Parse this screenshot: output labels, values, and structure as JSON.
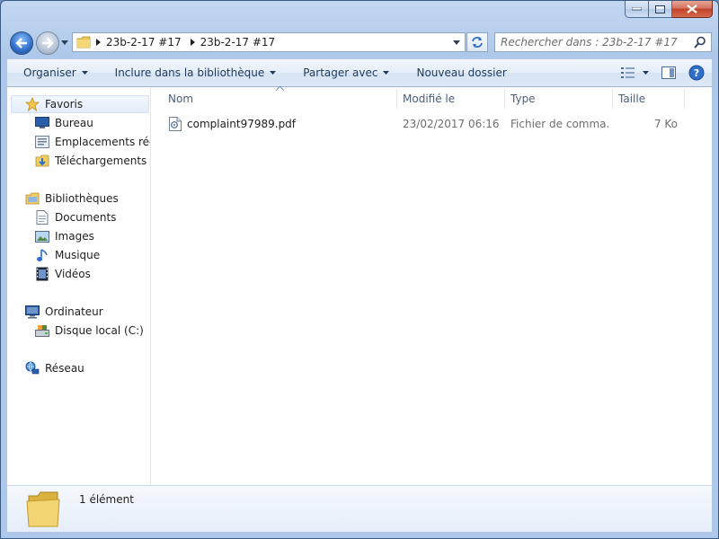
{
  "window": {
    "caption_buttons": [
      "minimize",
      "maximize",
      "close"
    ]
  },
  "address": {
    "crumbs": [
      "23b-2-17 #17",
      "23b-2-17 #17"
    ]
  },
  "search": {
    "placeholder": "Rechercher dans : 23b-2-17 #17"
  },
  "toolbar": {
    "organize": "Organiser",
    "include": "Inclure dans la bibliothèque",
    "share": "Partager avec",
    "new_folder": "Nouveau dossier"
  },
  "navpane": {
    "favorites": {
      "label": "Favoris",
      "items": [
        "Bureau",
        "Emplacements récents",
        "Téléchargements"
      ]
    },
    "libraries": {
      "label": "Bibliothèques",
      "items": [
        "Documents",
        "Images",
        "Musique",
        "Vidéos"
      ]
    },
    "computer": {
      "label": "Ordinateur",
      "items": [
        "Disque local (C:)"
      ]
    },
    "network": {
      "label": "Réseau"
    }
  },
  "columns": {
    "name": "Nom",
    "modified": "Modifié le",
    "type": "Type",
    "size": "Taille"
  },
  "files": [
    {
      "name": "complaint97989.pdf",
      "modified": "23/02/2017 06:16",
      "type": "Fichier de comma...",
      "size": "7 Ko"
    }
  ],
  "status": {
    "count": "1 élément"
  },
  "colors": {
    "frame": "#b9d1ee",
    "toolbar_text": "#1e395b",
    "header_text": "#4c607a"
  }
}
